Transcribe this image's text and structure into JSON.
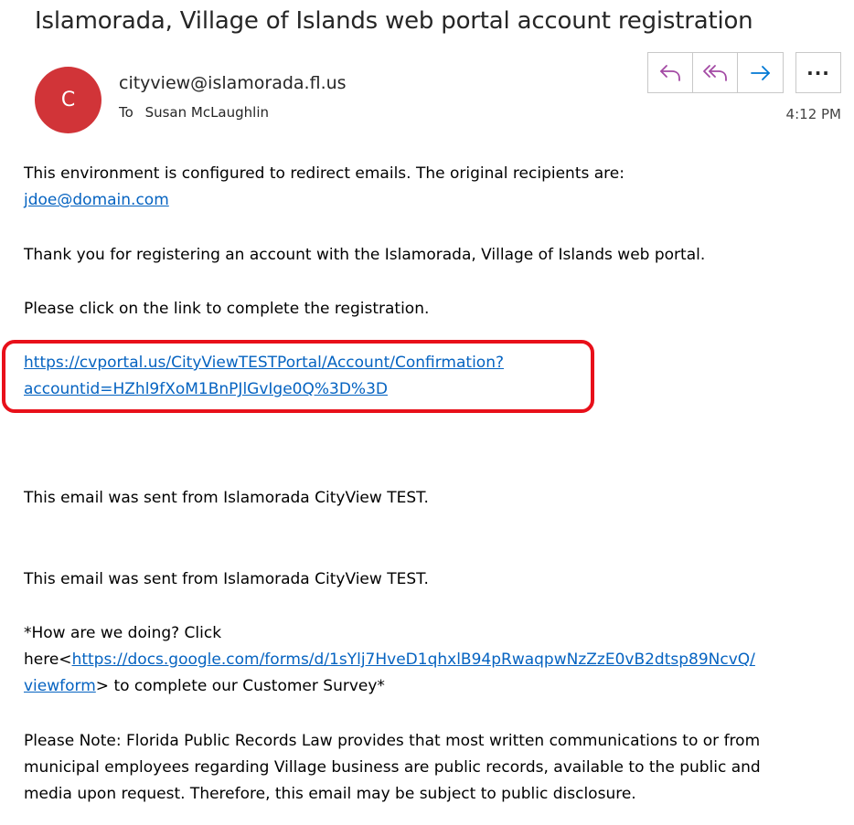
{
  "email": {
    "subject": "Islamorada, Village of Islands web portal account registration",
    "avatar_initial": "C",
    "sender": "cityview@islamorada.fl.us",
    "to_label": "To",
    "recipient": "Susan McLaughlin",
    "time": "4:12 PM",
    "more_label": "···"
  },
  "icons": {
    "reply": "reply-icon",
    "reply_all": "reply-all-icon",
    "forward": "forward-icon",
    "more": "more-icon",
    "accent_color": "#a349a4",
    "forward_color": "#0078d4",
    "avatar_color": "#d13438",
    "highlight_color": "#e8101a"
  },
  "body": {
    "redirect_notice": "This environment is configured to redirect emails.  The original recipients are:",
    "redirect_email": "jdoe@domain.com",
    "thanks": "Thank you for registering an account with the Islamorada, Village of Islands web portal.",
    "instruction": "Please click on the link to complete the registration.",
    "confirm_link_line1": "https://cvportal.us/CityViewTESTPortal/Account/Confirmation?",
    "confirm_link_line2": "accountid=HZhl9fXoM1BnPJlGvIge0Q%3D%3D",
    "sent_from_1": "This email was sent from Islamorada CityView TEST.",
    "sent_from_2": "This email was sent from Islamorada CityView TEST.",
    "survey_line1": "*How are we doing? Click",
    "survey_prefix": "here<",
    "survey_link_line1": "https://docs.google.com/forms/d/1sYlj7HveD1qhxlB94pRwaqpwNzZzE0vB2dtsp89NcvQ/",
    "survey_link_line2": "viewform",
    "survey_suffix": "> to complete our Customer Survey*",
    "note_line1": "Please Note: Florida Public Records Law provides that most written communications to or from",
    "note_line2": "municipal employees regarding Village business are public records, available to the public and",
    "note_line3": "media upon request. Therefore, this email may be subject to public disclosure."
  }
}
